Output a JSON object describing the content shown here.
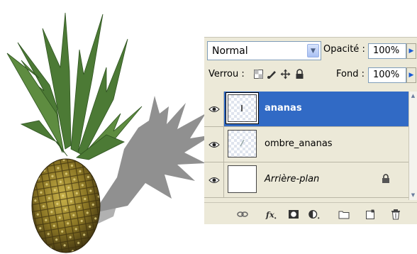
{
  "panel": {
    "blend_mode": "Normal",
    "opacity_label": "Opacité :",
    "opacity_value": "100%",
    "lock_label": "Verrou :",
    "fill_label": "Fond :",
    "fill_value": "100%"
  },
  "layers": [
    {
      "name": "ananas",
      "selected": true,
      "visible": true
    },
    {
      "name": "ombre_ananas",
      "selected": false,
      "visible": true
    },
    {
      "name": "Arrière-plan",
      "selected": false,
      "visible": true,
      "locked": true
    }
  ],
  "colors": {
    "selection": "#316ac5",
    "panel_bg": "#ece9d8",
    "accent_arrow": "#1a5bd6"
  },
  "icons": [
    "link-layers-icon",
    "fx-icon",
    "layer-mask-icon",
    "adjustment-layer-icon",
    "new-group-icon",
    "new-layer-icon",
    "trash-icon"
  ]
}
